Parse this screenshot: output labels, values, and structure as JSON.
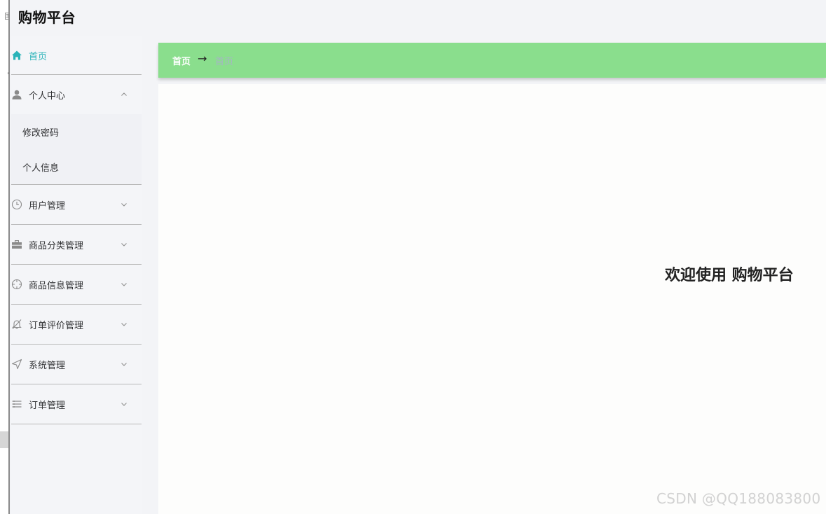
{
  "app": {
    "title": "购物平台"
  },
  "edge": {
    "glyph": "匡"
  },
  "sidebar": {
    "items": [
      {
        "label": "首页",
        "icon": "home-icon",
        "active": true
      },
      {
        "label": "个人中心",
        "icon": "user-icon",
        "expanded": true,
        "children": [
          {
            "label": "修改密码"
          },
          {
            "label": "个人信息"
          }
        ]
      },
      {
        "label": "用户管理",
        "icon": "clock-icon"
      },
      {
        "label": "商品分类管理",
        "icon": "briefcase-icon"
      },
      {
        "label": "商品信息管理",
        "icon": "crosshair-icon"
      },
      {
        "label": "订单评价管理",
        "icon": "bell-off-icon"
      },
      {
        "label": "系统管理",
        "icon": "navigation-icon"
      },
      {
        "label": "订单管理",
        "icon": "list-icon"
      }
    ]
  },
  "breadcrumb": {
    "home": "首页",
    "arrow": "→",
    "current": "首页"
  },
  "main": {
    "welcome": "欢迎使用 购物平台"
  },
  "watermark": "CSDN @QQ188083800",
  "colors": {
    "accent": "#2ab3b8",
    "breadcrumb_bg": "#8ade8d",
    "sidebar_bg": "#f4f5f8",
    "icon": "#8a8a8a"
  }
}
